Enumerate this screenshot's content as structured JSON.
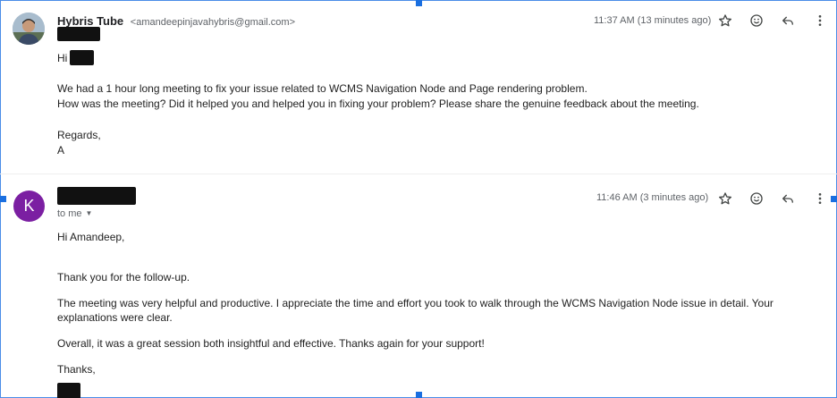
{
  "messages": [
    {
      "sender_name": "Hybris Tube",
      "sender_email": "<amandeepinjavahybris@gmail.com>",
      "time": "11:37 AM (13 minutes ago)",
      "greeting": "Hi",
      "body": [
        "We had a 1 hour long meeting to fix your issue related to WCMS Navigation Node and Page rendering problem.",
        "How was the meeting? Did it helped you and helped you in fixing your problem? Please share the genuine feedback about the meeting."
      ],
      "signoff": "Regards,",
      "signature": "A",
      "icons": [
        "star-icon",
        "emoji-icon",
        "reply-icon",
        "more-vert-icon"
      ]
    },
    {
      "avatar_letter": "K",
      "avatar_color": "#7b1fa2",
      "time": "11:46 AM (3 minutes ago)",
      "recipient": "to me",
      "greeting": "Hi Amandeep,",
      "body": [
        "Thank you for the follow-up.",
        "The meeting was very helpful and productive. I appreciate the time and effort you took to walk through the WCMS Navigation Node issue in detail. Your explanations were clear.",
        "Overall, it was a great session both insightful and effective. Thanks again for your support!"
      ],
      "signoff": "Thanks,",
      "icons": [
        "star-icon",
        "emoji-icon",
        "reply-icon",
        "more-vert-icon"
      ]
    }
  ],
  "colors": {
    "selection_handle": "#1a6fe0",
    "avatar_k": "#7b1fa2",
    "redaction": "#111111"
  }
}
